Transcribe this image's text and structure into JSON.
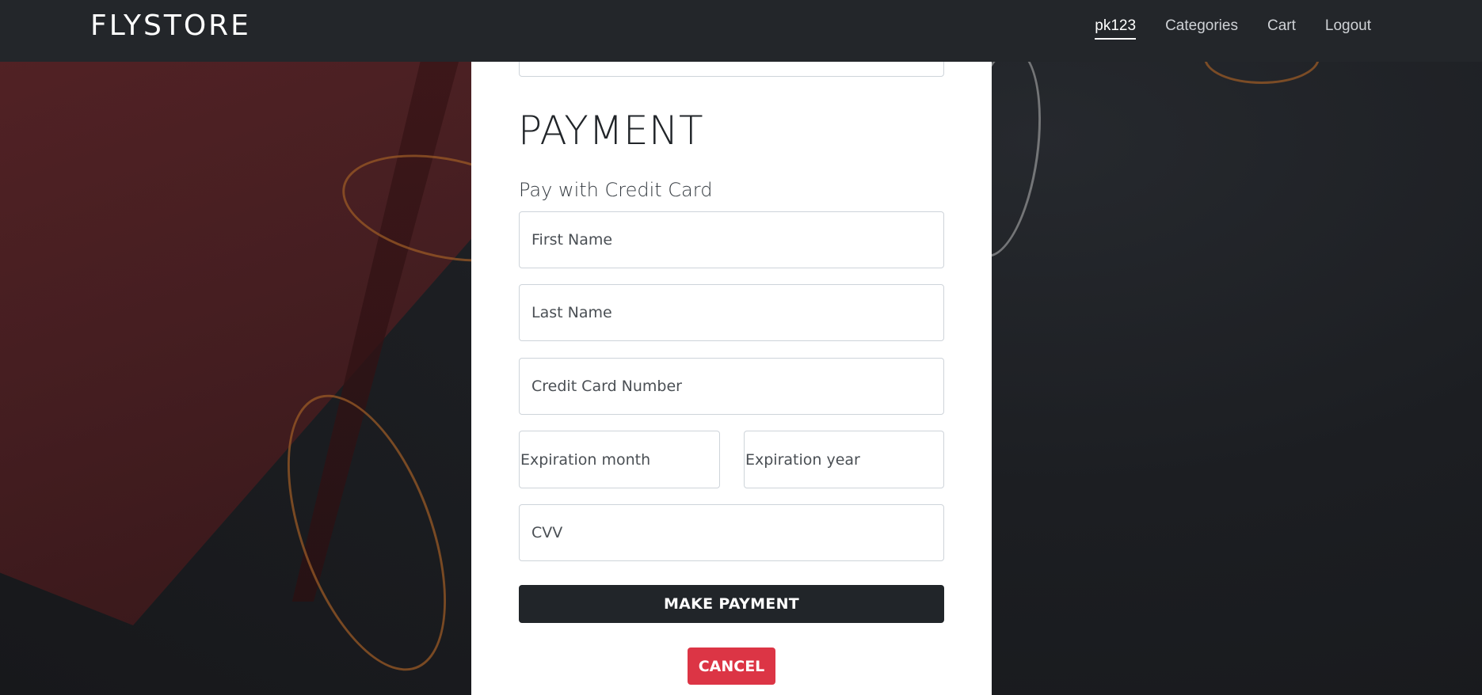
{
  "navbar": {
    "brand": "FLYSTORE",
    "links": [
      {
        "label": "pk123",
        "active": true
      },
      {
        "label": "Categories"
      },
      {
        "label": "Cart"
      },
      {
        "label": "Logout"
      }
    ]
  },
  "payment": {
    "title": "PAYMENT",
    "subtitle": "Pay with Credit Card",
    "fields": {
      "first_name": {
        "placeholder": "First Name",
        "value": ""
      },
      "last_name": {
        "placeholder": "Last Name",
        "value": ""
      },
      "card_number": {
        "placeholder": "Credit Card Number",
        "value": ""
      },
      "exp_month": {
        "placeholder": "Expiration month",
        "value": ""
      },
      "exp_year": {
        "placeholder": "Expiration year",
        "value": ""
      },
      "cvv": {
        "placeholder": "CVV",
        "value": ""
      }
    },
    "make_payment_label": "MAKE PAYMENT",
    "cancel_label": "CANCEL"
  },
  "colors": {
    "navbar_bg": "#23262a",
    "primary_button": "#212529",
    "cancel_button": "#dc3545",
    "card_bg": "#ffffff"
  }
}
